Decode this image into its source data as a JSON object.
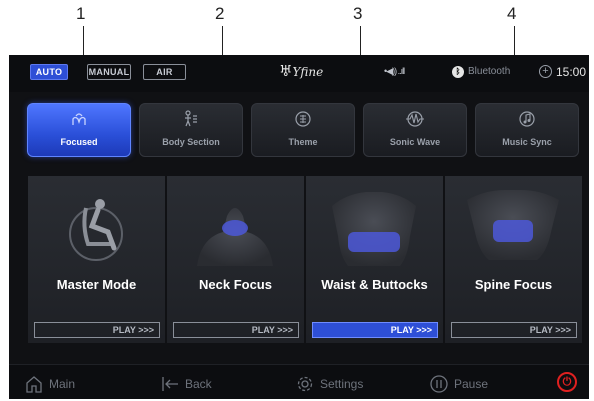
{
  "callouts": [
    "1",
    "2",
    "3",
    "4"
  ],
  "status_bar": {
    "modes": [
      {
        "label": "AUTO",
        "active": true
      },
      {
        "label": "MANUAL",
        "active": false
      },
      {
        "label": "AIR",
        "active": false
      }
    ],
    "logo": "Yfine",
    "bluetooth_label": "Bluetooth",
    "time": "15:00"
  },
  "tabs": [
    {
      "label": "Focused",
      "icon": "hands-icon",
      "active": true
    },
    {
      "label": "Body Section",
      "icon": "body-icon",
      "active": false
    },
    {
      "label": "Theme",
      "icon": "book-icon",
      "active": false
    },
    {
      "label": "Sonic Wave",
      "icon": "wave-icon",
      "active": false
    },
    {
      "label": "Music Sync",
      "icon": "music-note-icon",
      "active": false
    }
  ],
  "cards": [
    {
      "title": "Master Mode",
      "play": "PLAY >>>",
      "active": false
    },
    {
      "title": "Neck Focus",
      "play": "PLAY >>>",
      "active": false
    },
    {
      "title": "Waist & Buttocks",
      "play": "PLAY >>>",
      "active": true
    },
    {
      "title": "Spine Focus",
      "play": "PLAY >>>",
      "active": false
    }
  ],
  "bottom_bar": {
    "main": "Main",
    "back": "Back",
    "settings": "Settings",
    "pause": "Pause"
  },
  "colors": {
    "accent": "#2e4fd6",
    "background": "#101114",
    "power": "#e02020"
  }
}
